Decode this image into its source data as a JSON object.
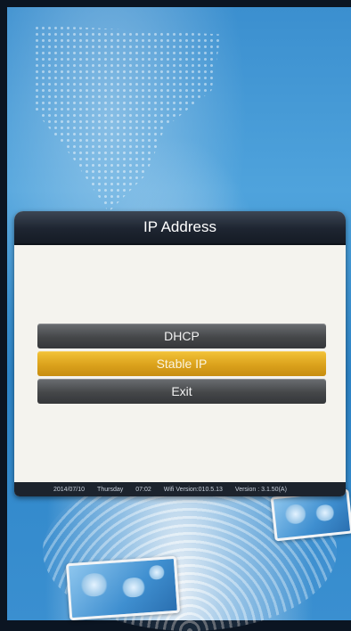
{
  "dialog": {
    "title": "IP Address",
    "menu": [
      {
        "label": "DHCP",
        "selected": false
      },
      {
        "label": "Stable IP",
        "selected": true
      },
      {
        "label": "Exit",
        "selected": false
      }
    ]
  },
  "statusbar": {
    "date": "2014/07/10",
    "weekday": "Thursday",
    "time": "07:02",
    "wifi_version": "Wifi Version:010.5.13",
    "version": "Version : 3.1.50(A)"
  },
  "colors": {
    "header": "#1e2531",
    "selected": "#dba21c",
    "item": "#454749",
    "panel": "#f4f3ee"
  }
}
